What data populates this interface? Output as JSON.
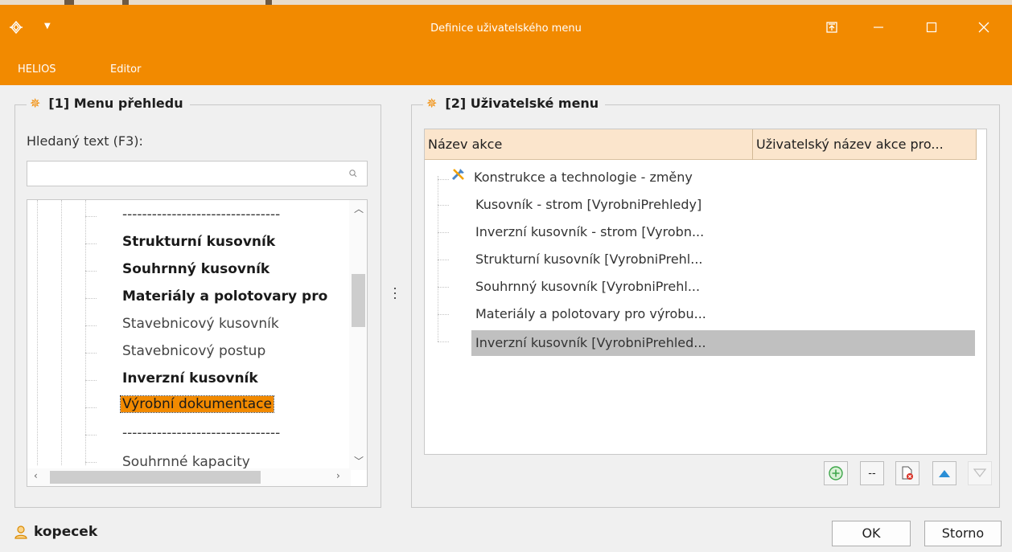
{
  "window": {
    "title": "Definice uživatelského menu",
    "accent_color": "#f28a00",
    "icons": [
      "app-logo-icon",
      "quick-access-dropdown-icon",
      "pin-window-icon",
      "minimize-icon",
      "maximize-icon",
      "close-icon"
    ]
  },
  "menubar": {
    "items": [
      "HELIOS",
      "Editor"
    ]
  },
  "left_panel": {
    "title": "[1] Menu přehledu",
    "search_label": "Hledaný text (F3):",
    "search_value": "",
    "tree_items": [
      {
        "label": "--------------------------------",
        "style": "separator"
      },
      {
        "label": "Strukturní kusovník",
        "style": "bold"
      },
      {
        "label": "Souhrnný kusovník",
        "style": "bold"
      },
      {
        "label": "Materiály a polotovary pro",
        "style": "bold"
      },
      {
        "label": "Stavebnicový kusovník",
        "style": "normal"
      },
      {
        "label": "Stavebnicový postup",
        "style": "normal"
      },
      {
        "label": "Inverzní kusovník",
        "style": "bold"
      },
      {
        "label": "Výrobní dokumentace",
        "style": "selected"
      },
      {
        "label": "--------------------------------",
        "style": "separator"
      },
      {
        "label": "Souhrnné kapacity",
        "style": "normal"
      }
    ]
  },
  "right_panel": {
    "title": "[2] Uživatelské menu",
    "columns": [
      "Název akce",
      "Uživatelský název akce pro..."
    ],
    "rows": [
      {
        "label": "Konstrukce a technologie - změny",
        "root": true
      },
      {
        "label": "Kusovník - strom [VyrobniPrehledy]"
      },
      {
        "label": "Inverzní kusovník - strom [Vyrobn..."
      },
      {
        "label": "Strukturní kusovník [VyrobniPrehl..."
      },
      {
        "label": "Souhrnný kusovník [VyrobniPrehl..."
      },
      {
        "label": "Materiály a polotovary pro výrobu..."
      },
      {
        "label": "Inverzní kusovník [VyrobniPrehled...",
        "selected": true
      }
    ],
    "toolbar": {
      "add_label": "+",
      "separator_label": "--",
      "delete_label": "delete",
      "move_up_label": "move up",
      "move_down_label": "move down"
    }
  },
  "footer": {
    "user": "kopecek",
    "ok_label": "OK",
    "cancel_label": "Storno"
  }
}
